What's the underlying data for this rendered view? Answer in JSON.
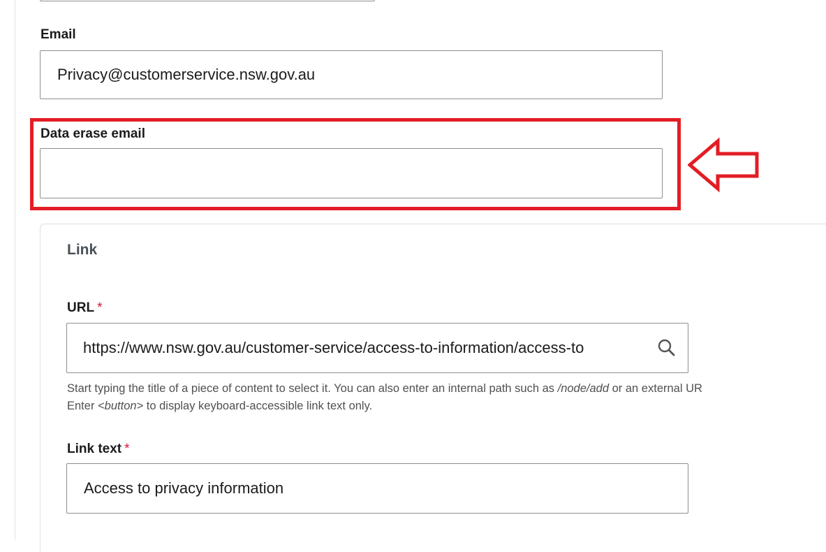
{
  "form": {
    "email": {
      "label": "Email",
      "value": "Privacy@customerservice.nsw.gov.au"
    },
    "data_erase_email": {
      "label": "Data erase email",
      "value": ""
    },
    "link_group": {
      "title": "Link",
      "url": {
        "label": "URL",
        "required_mark": "*",
        "value": "https://www.nsw.gov.au/customer-service/access-to-information/access-to",
        "help_line1_pre": "Start typing the title of a piece of content to select it. You can also enter an internal path such as ",
        "help_line1_em": "/node/add",
        "help_line1_post": " or an external UR",
        "help_line2_pre": "Enter ",
        "help_line2_em": "<button>",
        "help_line2_post": " to display keyboard-accessible link text only."
      },
      "link_text": {
        "label": "Link text",
        "required_mark": "*",
        "value": "Access to privacy information"
      }
    }
  },
  "annotation": {
    "highlight_color": "#e31d25",
    "arrow_icon": "left-arrow-outline-icon"
  },
  "colors": {
    "required": "#d7153a",
    "input_border": "#8e8e8e",
    "group_title": "#495057",
    "help_text": "#505050"
  }
}
